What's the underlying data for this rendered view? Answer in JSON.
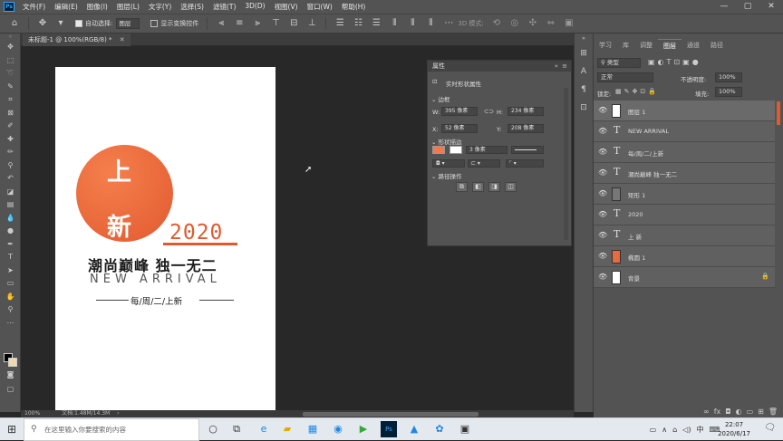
{
  "app": {
    "logo": "Ps"
  },
  "menubar": {
    "items": [
      "文件(F)",
      "编辑(E)",
      "图像(I)",
      "图层(L)",
      "文字(Y)",
      "选择(S)",
      "滤镜(T)",
      "3D(D)",
      "视图(V)",
      "窗口(W)",
      "帮助(H)"
    ]
  },
  "window_controls": {
    "minimize": "—",
    "maximize": "▢",
    "close": "✕"
  },
  "options_bar": {
    "auto_select_label": "自动选择:",
    "auto_select_value": "图层",
    "show_transform_label": "显示变换控件",
    "mode_3d_label": "3D 模式:"
  },
  "document": {
    "tab_title": "未标题-1 @ 100%(RGB/8) *",
    "zoom": "100%",
    "doc_info": "文档:1.48M/14.3M"
  },
  "artwork": {
    "char1": "上",
    "char2": "新",
    "year": "2020",
    "slogan": "潮尚巅峰 独一无二",
    "new_arrival": "NEW ARRIVAL",
    "weekly": "每/周/二/上新",
    "accent": "#e05a2f"
  },
  "properties": {
    "title": "属性",
    "subtitle": "实时形状属性",
    "bounds_label": "边框",
    "w_label": "W:",
    "w_value": "395 像素",
    "h_label": "H:",
    "h_value": "234 像素",
    "x_label": "X:",
    "x_value": "52 像素",
    "y_label": "Y:",
    "y_value": "208 像素",
    "shape_label": "形状描边",
    "stroke_width": "3 像素",
    "path_ops_label": "路径操作"
  },
  "layers_panel": {
    "tabs": [
      "学习",
      "库",
      "调整",
      "图层",
      "通道",
      "路径"
    ],
    "active_tab": "图层",
    "filter_kind": "类型",
    "blend_mode": "正常",
    "opacity_label": "不透明度:",
    "opacity_value": "100%",
    "lock_label": "锁定:",
    "fill_label": "填充:",
    "fill_value": "100%",
    "layers": [
      {
        "name": "图层 1",
        "kind": "pixel"
      },
      {
        "name": "NEW ARRIVAL",
        "kind": "text"
      },
      {
        "name": "每/周/二/上新",
        "kind": "text"
      },
      {
        "name": "潮尚巅峰 独一无二",
        "kind": "text"
      },
      {
        "name": "矩形 1",
        "kind": "shape"
      },
      {
        "name": "2020",
        "kind": "text"
      },
      {
        "name": "上 新",
        "kind": "text"
      },
      {
        "name": "椭圆 1",
        "kind": "shape"
      },
      {
        "name": "背景",
        "kind": "pixel"
      }
    ]
  },
  "taskbar": {
    "search_placeholder": "在这里输入你要搜索的内容",
    "ime": "中",
    "time": "22:07",
    "date": "2020/6/17"
  }
}
